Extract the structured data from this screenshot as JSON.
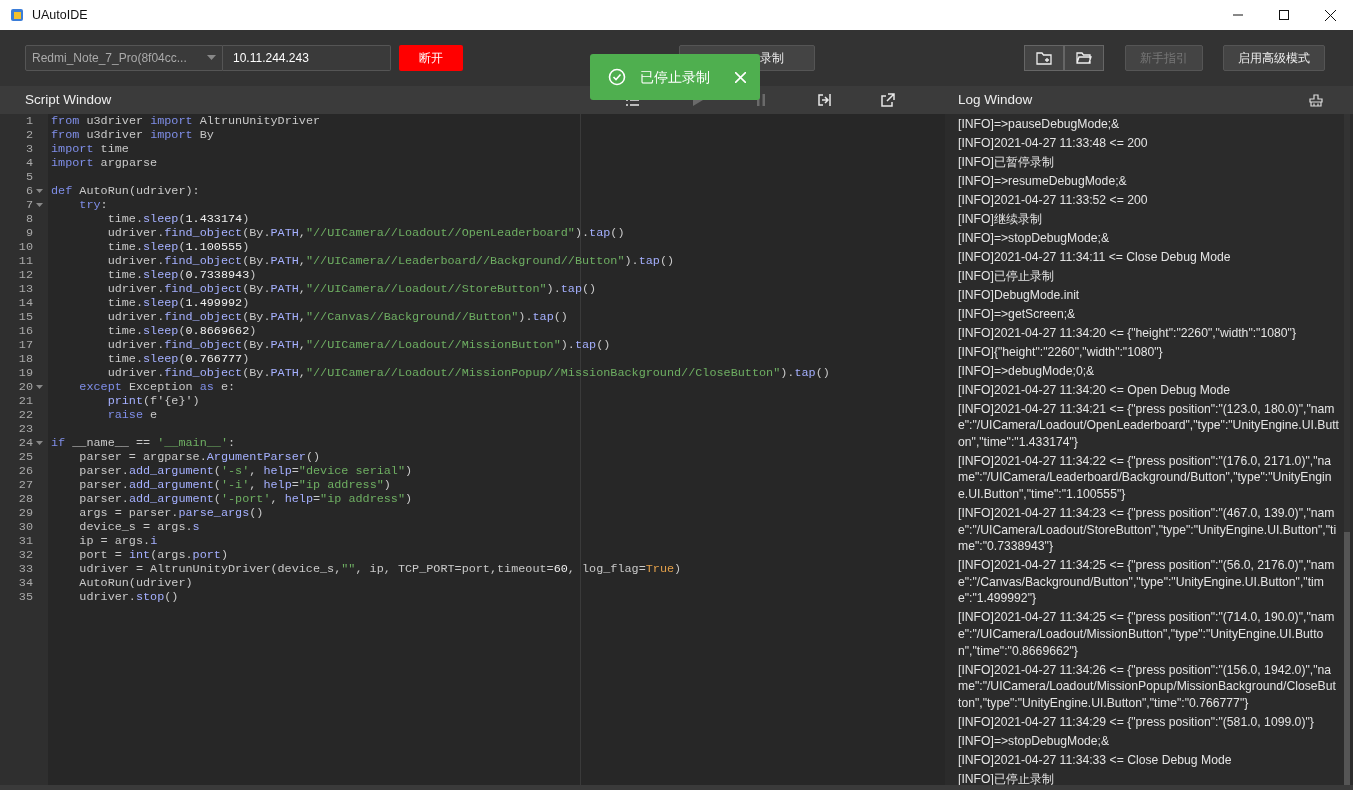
{
  "window": {
    "title": "UAutoIDE"
  },
  "toolbar": {
    "device_select": {
      "value": "Redmi_Note_7_Pro(8f04cc..."
    },
    "ip_field": {
      "value": "10.11.244.243"
    },
    "disconnect_button": {
      "label": "断开"
    },
    "record_button": {
      "label": "录制"
    },
    "guide_button": {
      "label": "新手指引",
      "disabled": true
    },
    "advanced_button": {
      "label": "启用高级模式",
      "disabled": false
    }
  },
  "toast": {
    "message": "已停止录制"
  },
  "script_window": {
    "title": "Script Window",
    "tools": [
      {
        "kind": "list",
        "disabled": false
      },
      {
        "kind": "play",
        "disabled": true
      },
      {
        "kind": "pause",
        "disabled": true
      },
      {
        "kind": "export",
        "disabled": false
      },
      {
        "kind": "popout",
        "disabled": false
      }
    ],
    "lines": [
      {
        "number": "1",
        "foldable": false,
        "tokens": [
          {
            "kind": "keyword",
            "text": "from"
          },
          {
            "kind": "plain",
            "text": " u3driver "
          },
          {
            "kind": "keyword",
            "text": "import"
          },
          {
            "kind": "plain",
            "text": " AltrunUnityDriver"
          }
        ]
      },
      {
        "number": "2",
        "foldable": false,
        "tokens": [
          {
            "kind": "keyword",
            "text": "from"
          },
          {
            "kind": "plain",
            "text": " u3driver "
          },
          {
            "kind": "keyword",
            "text": "import"
          },
          {
            "kind": "plain",
            "text": " By"
          }
        ]
      },
      {
        "number": "3",
        "foldable": false,
        "tokens": [
          {
            "kind": "keyword",
            "text": "import"
          },
          {
            "kind": "plain",
            "text": " time"
          }
        ]
      },
      {
        "number": "4",
        "foldable": false,
        "tokens": [
          {
            "kind": "keyword",
            "text": "import"
          },
          {
            "kind": "plain",
            "text": " argparse"
          }
        ]
      },
      {
        "number": "5",
        "foldable": false
      },
      {
        "number": "6",
        "foldable": true,
        "tokens": [
          {
            "kind": "keyword",
            "text": "def"
          },
          {
            "kind": "plain",
            "text": " AutoRun(udriver):"
          }
        ]
      },
      {
        "number": "7",
        "foldable": true,
        "tokens": [
          {
            "kind": "keyword",
            "text": "    try"
          },
          {
            "kind": "plain",
            "text": ":"
          }
        ]
      },
      {
        "number": "8",
        "foldable": false,
        "tokens": [
          {
            "kind": "plain",
            "text": "        time."
          },
          {
            "kind": "call",
            "text": "sleep"
          },
          {
            "kind": "plain",
            "text": "("
          },
          {
            "kind": "number",
            "text": "1.433174"
          },
          {
            "kind": "plain",
            "text": ")"
          }
        ]
      },
      {
        "number": "9",
        "foldable": false,
        "tokens": [
          {
            "kind": "plain",
            "text": "        udriver."
          },
          {
            "kind": "call",
            "text": "find_object"
          },
          {
            "kind": "plain",
            "text": "(By."
          },
          {
            "kind": "call",
            "text": "PATH"
          },
          {
            "kind": "plain",
            "text": ","
          },
          {
            "kind": "string",
            "text": "\"//UICamera//Loadout//OpenLeaderboard\""
          },
          {
            "kind": "plain",
            "text": ")."
          },
          {
            "kind": "call",
            "text": "tap"
          },
          {
            "kind": "plain",
            "text": "()"
          }
        ]
      },
      {
        "number": "10",
        "foldable": false,
        "tokens": [
          {
            "kind": "plain",
            "text": "        time."
          },
          {
            "kind": "call",
            "text": "sleep"
          },
          {
            "kind": "plain",
            "text": "("
          },
          {
            "kind": "number",
            "text": "1.100555"
          },
          {
            "kind": "plain",
            "text": ")"
          }
        ]
      },
      {
        "number": "11",
        "foldable": false,
        "tokens": [
          {
            "kind": "plain",
            "text": "        udriver."
          },
          {
            "kind": "call",
            "text": "find_object"
          },
          {
            "kind": "plain",
            "text": "(By."
          },
          {
            "kind": "call",
            "text": "PATH"
          },
          {
            "kind": "plain",
            "text": ","
          },
          {
            "kind": "string",
            "text": "\"//UICamera//Leaderboard//Background//Button\""
          },
          {
            "kind": "plain",
            "text": ")."
          },
          {
            "kind": "call",
            "text": "tap"
          },
          {
            "kind": "plain",
            "text": "()"
          }
        ]
      },
      {
        "number": "12",
        "foldable": false,
        "tokens": [
          {
            "kind": "plain",
            "text": "        time."
          },
          {
            "kind": "call",
            "text": "sleep"
          },
          {
            "kind": "plain",
            "text": "("
          },
          {
            "kind": "number",
            "text": "0.7338943"
          },
          {
            "kind": "plain",
            "text": ")"
          }
        ]
      },
      {
        "number": "13",
        "foldable": false,
        "tokens": [
          {
            "kind": "plain",
            "text": "        udriver."
          },
          {
            "kind": "call",
            "text": "find_object"
          },
          {
            "kind": "plain",
            "text": "(By."
          },
          {
            "kind": "call",
            "text": "PATH"
          },
          {
            "kind": "plain",
            "text": ","
          },
          {
            "kind": "string",
            "text": "\"//UICamera//Loadout//StoreButton\""
          },
          {
            "kind": "plain",
            "text": ")."
          },
          {
            "kind": "call",
            "text": "tap"
          },
          {
            "kind": "plain",
            "text": "()"
          }
        ]
      },
      {
        "number": "14",
        "foldable": false,
        "tokens": [
          {
            "kind": "plain",
            "text": "        time."
          },
          {
            "kind": "call",
            "text": "sleep"
          },
          {
            "kind": "plain",
            "text": "("
          },
          {
            "kind": "number",
            "text": "1.499992"
          },
          {
            "kind": "plain",
            "text": ")"
          }
        ]
      },
      {
        "number": "15",
        "foldable": false,
        "tokens": [
          {
            "kind": "plain",
            "text": "        udriver."
          },
          {
            "kind": "call",
            "text": "find_object"
          },
          {
            "kind": "plain",
            "text": "(By."
          },
          {
            "kind": "call",
            "text": "PATH"
          },
          {
            "kind": "plain",
            "text": ","
          },
          {
            "kind": "string",
            "text": "\"//Canvas//Background//Button\""
          },
          {
            "kind": "plain",
            "text": ")."
          },
          {
            "kind": "call",
            "text": "tap"
          },
          {
            "kind": "plain",
            "text": "()"
          }
        ]
      },
      {
        "number": "16",
        "foldable": false,
        "tokens": [
          {
            "kind": "plain",
            "text": "        time."
          },
          {
            "kind": "call",
            "text": "sleep"
          },
          {
            "kind": "plain",
            "text": "("
          },
          {
            "kind": "number",
            "text": "0.8669662"
          },
          {
            "kind": "plain",
            "text": ")"
          }
        ]
      },
      {
        "number": "17",
        "foldable": false,
        "tokens": [
          {
            "kind": "plain",
            "text": "        udriver."
          },
          {
            "kind": "call",
            "text": "find_object"
          },
          {
            "kind": "plain",
            "text": "(By."
          },
          {
            "kind": "call",
            "text": "PATH"
          },
          {
            "kind": "plain",
            "text": ","
          },
          {
            "kind": "string",
            "text": "\"//UICamera//Loadout//MissionButton\""
          },
          {
            "kind": "plain",
            "text": ")."
          },
          {
            "kind": "call",
            "text": "tap"
          },
          {
            "kind": "plain",
            "text": "()"
          }
        ]
      },
      {
        "number": "18",
        "foldable": false,
        "tokens": [
          {
            "kind": "plain",
            "text": "        time."
          },
          {
            "kind": "call",
            "text": "sleep"
          },
          {
            "kind": "plain",
            "text": "("
          },
          {
            "kind": "number",
            "text": "0.766777"
          },
          {
            "kind": "plain",
            "text": ")"
          }
        ]
      },
      {
        "number": "19",
        "foldable": false,
        "tokens": [
          {
            "kind": "plain",
            "text": "        udriver."
          },
          {
            "kind": "call",
            "text": "find_object"
          },
          {
            "kind": "plain",
            "text": "(By."
          },
          {
            "kind": "call",
            "text": "PATH"
          },
          {
            "kind": "plain",
            "text": ","
          },
          {
            "kind": "string",
            "text": "\"//UICamera//Loadout//MissionPopup//MissionBackground//CloseButton\""
          },
          {
            "kind": "plain",
            "text": ")."
          },
          {
            "kind": "call",
            "text": "tap"
          },
          {
            "kind": "plain",
            "text": "()"
          }
        ]
      },
      {
        "number": "20",
        "foldable": true,
        "tokens": [
          {
            "kind": "keyword",
            "text": "    except"
          },
          {
            "kind": "plain",
            "text": " Exception "
          },
          {
            "kind": "keyword",
            "text": "as"
          },
          {
            "kind": "plain",
            "text": " e:"
          }
        ]
      },
      {
        "number": "21",
        "foldable": false,
        "tokens": [
          {
            "kind": "call",
            "text": "        print"
          },
          {
            "kind": "plain",
            "text": "(f'{e}')"
          }
        ]
      },
      {
        "number": "22",
        "foldable": false,
        "tokens": [
          {
            "kind": "keyword",
            "text": "        raise"
          },
          {
            "kind": "plain",
            "text": " e"
          }
        ]
      },
      {
        "number": "23",
        "foldable": false
      },
      {
        "number": "24",
        "foldable": true,
        "tokens": [
          {
            "kind": "keyword",
            "text": "if"
          },
          {
            "kind": "plain",
            "text": " __name__ == "
          },
          {
            "kind": "string",
            "text": "'__main__'"
          },
          {
            "kind": "plain",
            "text": ":"
          }
        ]
      },
      {
        "number": "25",
        "foldable": false,
        "tokens": [
          {
            "kind": "plain",
            "text": "    parser = argparse."
          },
          {
            "kind": "call",
            "text": "ArgumentParser"
          },
          {
            "kind": "plain",
            "text": "()"
          }
        ]
      },
      {
        "number": "26",
        "foldable": false,
        "tokens": [
          {
            "kind": "plain",
            "text": "    parser."
          },
          {
            "kind": "call",
            "text": "add_argument"
          },
          {
            "kind": "plain",
            "text": "("
          },
          {
            "kind": "string",
            "text": "'-s'"
          },
          {
            "kind": "plain",
            "text": ", "
          },
          {
            "kind": "call",
            "text": "help"
          },
          {
            "kind": "plain",
            "text": "="
          },
          {
            "kind": "string",
            "text": "\"device serial\""
          },
          {
            "kind": "plain",
            "text": ")"
          }
        ]
      },
      {
        "number": "27",
        "foldable": false,
        "tokens": [
          {
            "kind": "plain",
            "text": "    parser."
          },
          {
            "kind": "call",
            "text": "add_argument"
          },
          {
            "kind": "plain",
            "text": "("
          },
          {
            "kind": "string",
            "text": "'-i'"
          },
          {
            "kind": "plain",
            "text": ", "
          },
          {
            "kind": "call",
            "text": "help"
          },
          {
            "kind": "plain",
            "text": "="
          },
          {
            "kind": "string",
            "text": "\"ip address\""
          },
          {
            "kind": "plain",
            "text": ")"
          }
        ]
      },
      {
        "number": "28",
        "foldable": false,
        "tokens": [
          {
            "kind": "plain",
            "text": "    parser."
          },
          {
            "kind": "call",
            "text": "add_argument"
          },
          {
            "kind": "plain",
            "text": "("
          },
          {
            "kind": "string",
            "text": "'-port'"
          },
          {
            "kind": "plain",
            "text": ", "
          },
          {
            "kind": "call",
            "text": "help"
          },
          {
            "kind": "plain",
            "text": "="
          },
          {
            "kind": "string",
            "text": "\"ip address\""
          },
          {
            "kind": "plain",
            "text": ")"
          }
        ]
      },
      {
        "number": "29",
        "foldable": false,
        "tokens": [
          {
            "kind": "plain",
            "text": "    args = parser."
          },
          {
            "kind": "call",
            "text": "parse_args"
          },
          {
            "kind": "plain",
            "text": "()"
          }
        ]
      },
      {
        "number": "30",
        "foldable": false,
        "tokens": [
          {
            "kind": "plain",
            "text": "    device_s = args."
          },
          {
            "kind": "call",
            "text": "s"
          }
        ]
      },
      {
        "number": "31",
        "foldable": false,
        "tokens": [
          {
            "kind": "plain",
            "text": "    ip = args."
          },
          {
            "kind": "call",
            "text": "i"
          }
        ]
      },
      {
        "number": "32",
        "foldable": false,
        "tokens": [
          {
            "kind": "plain",
            "text": "    port = "
          },
          {
            "kind": "call",
            "text": "int"
          },
          {
            "kind": "plain",
            "text": "(args."
          },
          {
            "kind": "call",
            "text": "port"
          },
          {
            "kind": "plain",
            "text": ")"
          }
        ]
      },
      {
        "number": "33",
        "foldable": false,
        "tokens": [
          {
            "kind": "plain",
            "text": "    udriver = AltrunUnityDriver(device_s,"
          },
          {
            "kind": "string",
            "text": "\"\""
          },
          {
            "kind": "plain",
            "text": ", ip, TCP_PORT=port,timeout="
          },
          {
            "kind": "number",
            "text": "60"
          },
          {
            "kind": "plain",
            "text": ", log_flag="
          },
          {
            "kind": "constant",
            "text": "True"
          },
          {
            "kind": "plain",
            "text": ")"
          }
        ]
      },
      {
        "number": "34",
        "foldable": false,
        "tokens": [
          {
            "kind": "plain",
            "text": "    AutoRun(udriver)"
          }
        ]
      },
      {
        "number": "35",
        "foldable": false,
        "tokens": [
          {
            "kind": "plain",
            "text": "    udriver."
          },
          {
            "kind": "call",
            "text": "stop"
          },
          {
            "kind": "plain",
            "text": "()"
          }
        ]
      }
    ]
  },
  "log_window": {
    "title": "Log Window",
    "entries": [
      "[INFO]=>pauseDebugMode;&",
      "[INFO]2021-04-27 11:33:48 <= 200",
      "[INFO]已暂停录制",
      "[INFO]=>resumeDebugMode;&",
      "[INFO]2021-04-27 11:33:52 <= 200",
      "[INFO]继续录制",
      "[INFO]=>stopDebugMode;&",
      "[INFO]2021-04-27 11:34:11 <= Close Debug Mode",
      "[INFO]已停止录制",
      "[INFO]DebugMode.init",
      "[INFO]=>getScreen;&",
      "[INFO]2021-04-27 11:34:20 <= {\"height\":\"2260\",\"width\":\"1080\"}",
      "[INFO]{\"height\":\"2260\",\"width\":\"1080\"}",
      "[INFO]=>debugMode;0;&",
      "[INFO]2021-04-27 11:34:20 <= Open Debug Mode",
      "[INFO]2021-04-27 11:34:21 <= {\"press position\":\"(123.0, 180.0)\",\"name\":\"/UICamera/Loadout/OpenLeaderboard\",\"type\":\"UnityEngine.UI.Button\",\"time\":\"1.433174\"}",
      "[INFO]2021-04-27 11:34:22 <= {\"press position\":\"(176.0, 2171.0)\",\"name\":\"/UICamera/Leaderboard/Background/Button\",\"type\":\"UnityEngine.UI.Button\",\"time\":\"1.100555\"}",
      "[INFO]2021-04-27 11:34:23 <= {\"press position\":\"(467.0, 139.0)\",\"name\":\"/UICamera/Loadout/StoreButton\",\"type\":\"UnityEngine.UI.Button\",\"time\":\"0.7338943\"}",
      "[INFO]2021-04-27 11:34:25 <= {\"press position\":\"(56.0, 2176.0)\",\"name\":\"/Canvas/Background/Button\",\"type\":\"UnityEngine.UI.Button\",\"time\":\"1.499992\"}",
      "[INFO]2021-04-27 11:34:25 <= {\"press position\":\"(714.0, 190.0)\",\"name\":\"/UICamera/Loadout/MissionButton\",\"type\":\"UnityEngine.UI.Button\",\"time\":\"0.8669662\"}",
      "[INFO]2021-04-27 11:34:26 <= {\"press position\":\"(156.0, 1942.0)\",\"name\":\"/UICamera/Loadout/MissionPopup/MissionBackground/CloseButton\",\"type\":\"UnityEngine.UI.Button\",\"time\":\"0.766777\"}",
      "[INFO]2021-04-27 11:34:29 <= {\"press position\":\"(581.0, 1099.0)\"}",
      "[INFO]=>stopDebugMode;&",
      "[INFO]2021-04-27 11:34:33 <= Close Debug Mode",
      "[INFO]已停止录制"
    ]
  }
}
